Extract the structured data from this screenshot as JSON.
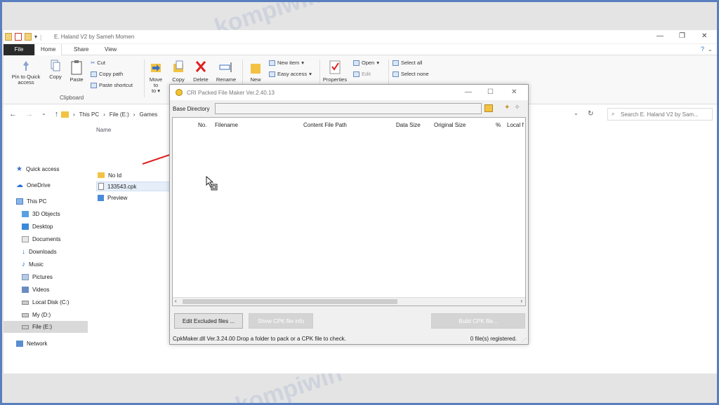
{
  "explorer": {
    "title": "E. Haland V2 by Sameh Momen",
    "tabs": [
      "File",
      "Home",
      "Share",
      "View"
    ],
    "ribbon": {
      "pin_label": "Pin to Quick access",
      "copy_label": "Copy",
      "paste_label": "Paste",
      "cut_label": "Cut",
      "copy_path_label": "Copy path",
      "paste_shortcut_label": "Paste shortcut",
      "clipboard_group": "Clipboard",
      "move_to_label": "Move to",
      "copy_to_label": "Copy",
      "delete_label": "Delete",
      "rename_label": "Rename",
      "new_folder_label": "New",
      "new_item_label": "New item",
      "easy_access_label": "Easy access",
      "properties_label": "Properties",
      "open_label": "Open",
      "edit_label": "Edit",
      "select_all_label": "Select all",
      "select_none_label": "Select none"
    },
    "breadcrumb": [
      "This PC",
      "File (E:)",
      "Games"
    ],
    "search_placeholder": "Search E. Haland V2 by Sam...",
    "nav": [
      {
        "label": "Quick access",
        "icon": "star-icon"
      },
      {
        "label": "OneDrive",
        "icon": "cloud-icon"
      },
      {
        "label": "This PC",
        "icon": "pc-icon"
      },
      {
        "label": "3D Objects",
        "icon": "cube-icon"
      },
      {
        "label": "Desktop",
        "icon": "desktop-icon"
      },
      {
        "label": "Documents",
        "icon": "document-icon"
      },
      {
        "label": "Downloads",
        "icon": "download-icon"
      },
      {
        "label": "Music",
        "icon": "music-icon"
      },
      {
        "label": "Pictures",
        "icon": "picture-icon"
      },
      {
        "label": "Videos",
        "icon": "video-icon"
      },
      {
        "label": "Local Disk (C:)",
        "icon": "drive-icon"
      },
      {
        "label": "My (D:)",
        "icon": "drive-icon"
      },
      {
        "label": "File (E:)",
        "icon": "drive-icon"
      },
      {
        "label": "Network",
        "icon": "network-icon"
      }
    ],
    "column_name": "Name",
    "files": [
      {
        "label": "No Id",
        "icon": "folder-icon"
      },
      {
        "label": "133543.cpk",
        "icon": "file-icon"
      },
      {
        "label": "Preview",
        "icon": "image-icon"
      }
    ]
  },
  "dialog": {
    "title": "CRI Packed File Maker Ver.2.40.13",
    "base_directory_label": "Base Directory",
    "base_directory_value": "",
    "columns": [
      "No.",
      "Filename",
      "Content File Path",
      "Data Size",
      "Original Size",
      "%",
      "Local f"
    ],
    "buttons": {
      "edit_excluded": "Edit Excluded files ...",
      "show_cpk_info": "Show CPK file info",
      "build_cpk": "Build CPK file..."
    },
    "status_left": "CpkMaker.dll Ver.3.24.00   Drop a folder to pack or a CPK file to check.",
    "status_right": "0 file(s) registered."
  },
  "colors": {
    "accent_blue": "#5a7fc0",
    "arrow_red": "#e02020",
    "folder_yellow": "#f3c243"
  }
}
